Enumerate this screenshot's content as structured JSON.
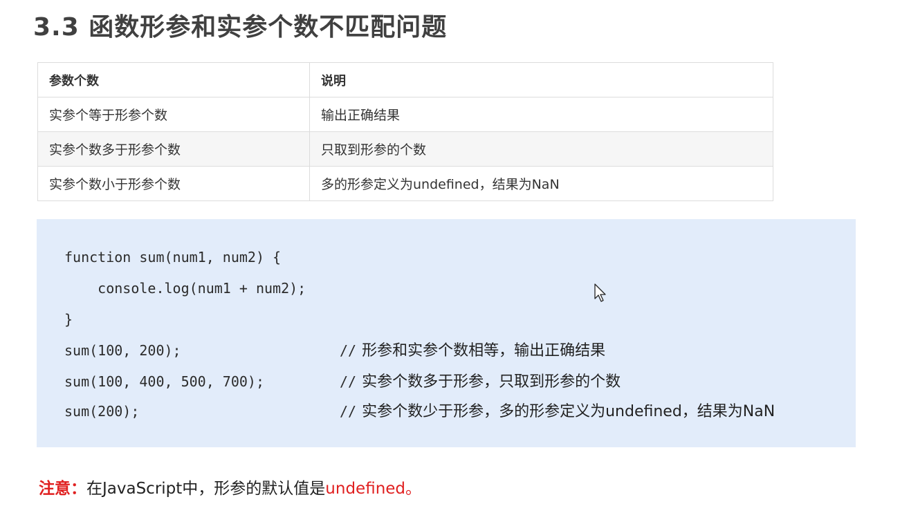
{
  "title": "3.3 函数形参和实参个数不匹配问题",
  "table": {
    "headers": [
      "参数个数",
      "说明"
    ],
    "rows": [
      [
        "实参个等于形参个数",
        "输出正确结果"
      ],
      [
        "实参个数多于形参个数",
        "只取到形参的个数"
      ],
      [
        "实参个数小于形参个数",
        "多的形参定义为undefined，结果为NaN"
      ]
    ]
  },
  "code": {
    "lines": [
      "function sum(num1, num2) {",
      "    console.log(num1 + num2);",
      "}",
      "sum(100, 200);",
      "sum(100, 400, 500, 700);",
      "sum(200);"
    ],
    "comment_marker": "//",
    "comments": [
      "形参和实参个数相等，输出正确结果",
      "实参个数多于形参，只取到形参的个数",
      "实参个数少于形参，多的形参定义为undefined，结果为NaN"
    ]
  },
  "note": {
    "label": "注意：",
    "text": "在JavaScript中，形参的默认值是",
    "highlight": "undefined",
    "end": "。"
  },
  "colors": {
    "code_bg": "#e2ecfa",
    "note_red": "#e02020",
    "title": "#404040"
  },
  "icons": [
    "mouse-cursor-icon"
  ]
}
